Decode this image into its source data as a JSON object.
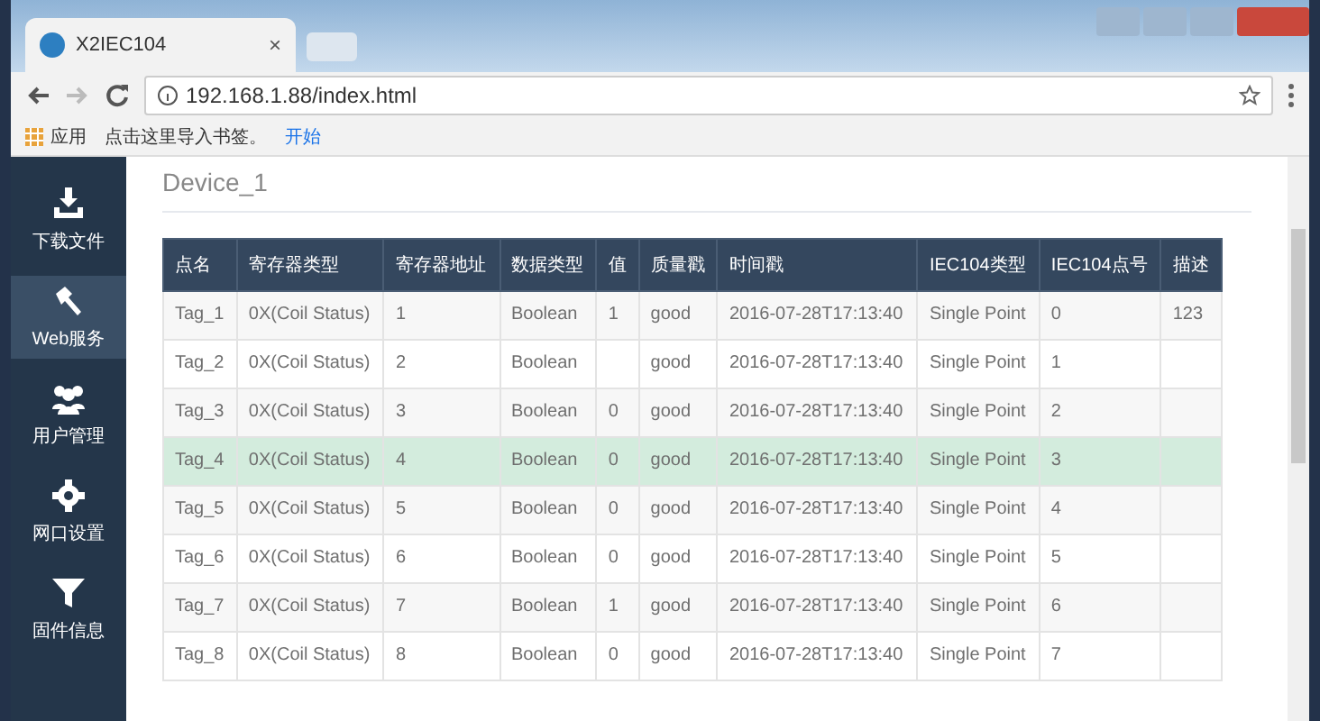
{
  "browser": {
    "tab_title": "X2IEC104",
    "tab_close": "×",
    "url": "192.168.1.88/index.html",
    "bookmarks": [
      {
        "kind": "apps",
        "label": "应用"
      },
      {
        "kind": "text",
        "label": "点击这里导入书签。"
      },
      {
        "kind": "link",
        "label": "开始"
      }
    ]
  },
  "sidebar": {
    "items": [
      {
        "kind": "download",
        "label": "下载文件",
        "selected": false
      },
      {
        "kind": "hammer",
        "label": "Web服务",
        "selected": true
      },
      {
        "kind": "users",
        "label": "用户管理",
        "selected": false
      },
      {
        "kind": "gear",
        "label": "网口设置",
        "selected": false
      },
      {
        "kind": "filter",
        "label": "固件信息",
        "selected": false
      }
    ]
  },
  "device_title": "Device_1",
  "table": {
    "columns": [
      "点名",
      "寄存器类型",
      "寄存器地址",
      "数据类型",
      "值",
      "质量戳",
      "时间戳",
      "IEC104类型",
      "IEC104点号",
      "描述"
    ],
    "rows": [
      {
        "selected": false,
        "cells": [
          "Tag_1",
          "0X(Coil Status)",
          "1",
          "Boolean",
          "1",
          "good",
          "2016-07-28T17:13:40",
          "Single Point",
          "0",
          "123"
        ]
      },
      {
        "selected": false,
        "cells": [
          "Tag_2",
          "0X(Coil Status)",
          "2",
          "Boolean",
          null,
          "good",
          "2016-07-28T17:13:40",
          "Single Point",
          "1",
          null
        ]
      },
      {
        "selected": false,
        "cells": [
          "Tag_3",
          "0X(Coil Status)",
          "3",
          "Boolean",
          "0",
          "good",
          "2016-07-28T17:13:40",
          "Single Point",
          "2",
          null
        ]
      },
      {
        "selected": true,
        "cells": [
          "Tag_4",
          "0X(Coil Status)",
          "4",
          "Boolean",
          "0",
          "good",
          "2016-07-28T17:13:40",
          "Single Point",
          "3",
          null
        ]
      },
      {
        "selected": false,
        "cells": [
          "Tag_5",
          "0X(Coil Status)",
          "5",
          "Boolean",
          "0",
          "good",
          "2016-07-28T17:13:40",
          "Single Point",
          "4",
          null
        ]
      },
      {
        "selected": false,
        "cells": [
          "Tag_6",
          "0X(Coil Status)",
          "6",
          "Boolean",
          "0",
          "good",
          "2016-07-28T17:13:40",
          "Single Point",
          "5",
          null
        ]
      },
      {
        "selected": false,
        "cells": [
          "Tag_7",
          "0X(Coil Status)",
          "7",
          "Boolean",
          "1",
          "good",
          "2016-07-28T17:13:40",
          "Single Point",
          "6",
          null
        ]
      },
      {
        "selected": false,
        "cells": [
          "Tag_8",
          "0X(Coil Status)",
          "8",
          "Boolean",
          "0",
          "good",
          "2016-07-28T17:13:40",
          "Single Point",
          "7",
          null
        ]
      }
    ]
  }
}
